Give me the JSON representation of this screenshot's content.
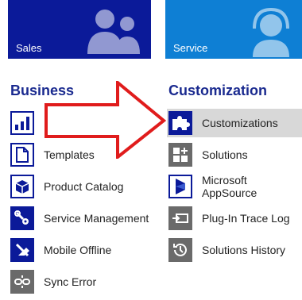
{
  "tiles": {
    "sales_label": "Sales",
    "service_label": "Service"
  },
  "business": {
    "heading": "Business",
    "items": [
      {
        "label": ""
      },
      {
        "label": "Templates"
      },
      {
        "label": "Product Catalog"
      },
      {
        "label": "Service Management"
      },
      {
        "label": "Mobile Offline"
      },
      {
        "label": "Sync Error"
      }
    ]
  },
  "customization": {
    "heading": "Customization",
    "items": [
      {
        "label": "Customizations"
      },
      {
        "label": "Solutions"
      },
      {
        "label": "Microsoft AppSource"
      },
      {
        "label": "Plug-In Trace Log"
      },
      {
        "label": "Solutions History"
      }
    ]
  },
  "colors": {
    "sales_tile": "#0b1a99",
    "service_tile": "#0e7fd4",
    "heading": "#1a2a8f",
    "arrow": "#e01c1c",
    "selected_row": "#d8d8d8"
  }
}
